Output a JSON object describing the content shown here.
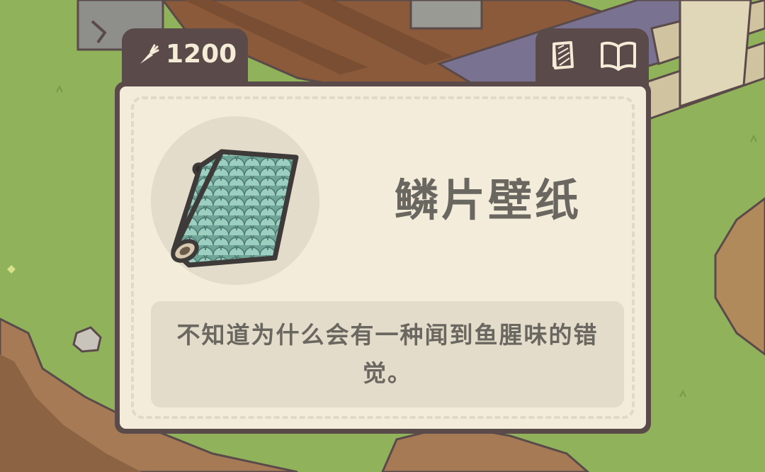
{
  "item": {
    "price": "1200",
    "currency_icon": "carrot-icon",
    "name": "鳞片壁纸",
    "description": "不知道为什么会有一种闻到鱼腥味的错觉。"
  },
  "actions": {
    "preview_icon": "wallpaper-preview-icon",
    "catalog_icon": "open-book-icon"
  },
  "colors": {
    "panel_border": "#5b4a4a",
    "panel_bg": "#f3ecdb",
    "text": "#6a6660",
    "price_text": "#f4ecd6",
    "grass": "#8fb25a"
  }
}
